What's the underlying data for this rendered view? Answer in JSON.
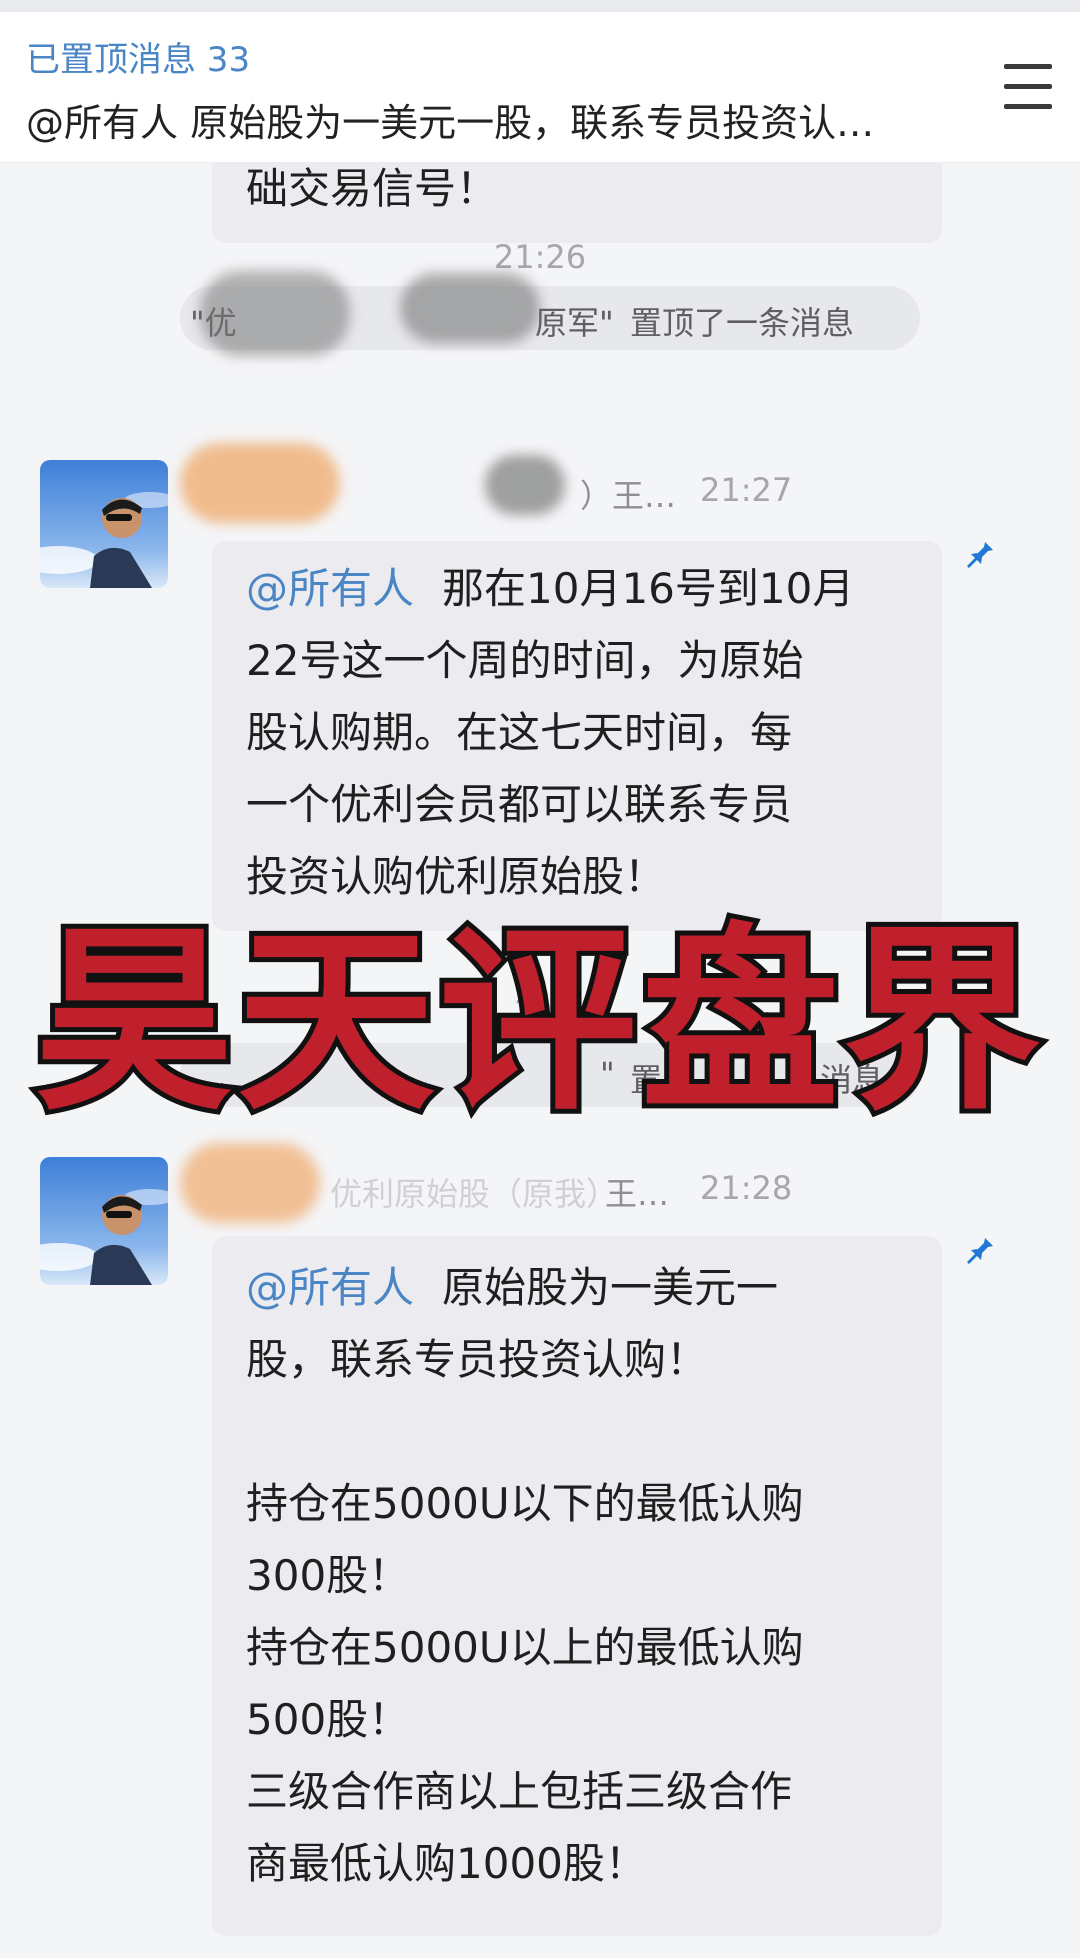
{
  "pinned": {
    "title": "已置顶消息 33",
    "message": "@所有人  原始股为一美元一股，联系专员投资认…"
  },
  "messages": {
    "partial_tail": "础交易信号！",
    "time_1": "21:26",
    "notice_1": {
      "left": "\"优",
      "middle": "原军\"",
      "right": "置顶了一条消息"
    },
    "msg1": {
      "sender_tail": "王…",
      "sender_paren": "）",
      "time": "21:27",
      "mention": "@所有人",
      "lines": [
        "那在10月16号到10月",
        "22号这一个周的时间，为原始",
        "股认购期。在这七天时间，每",
        "一个优利会员都可以联系专员",
        "投资认购优利原始股！"
      ]
    },
    "time_2": "21:",
    "notice_2": {
      "quote": "\"",
      "right_a": "置",
      "right_b": "消息"
    },
    "msg2": {
      "sender_blur": "优利原始股（原我）",
      "sender_tail": "王…",
      "time": "21:28",
      "mention": "@所有人",
      "lines": [
        "原始股为一美元一",
        "股，联系专员投资认购！",
        "",
        "持仓在5000U以下的最低认购",
        "300股！",
        "持仓在5000U以上的最低认购",
        "500股！",
        "三级合作商以上包括三级合作",
        "商最低认购1000股！"
      ]
    }
  },
  "watermark": "昊天评盘界",
  "icons": {
    "menu": "menu-icon",
    "pin": "pin-icon",
    "avatar": "avatar-photo"
  },
  "colors": {
    "accent": "#4a86c5",
    "watermark_red": "#c0202c",
    "pin_blue": "#1f78d6"
  }
}
